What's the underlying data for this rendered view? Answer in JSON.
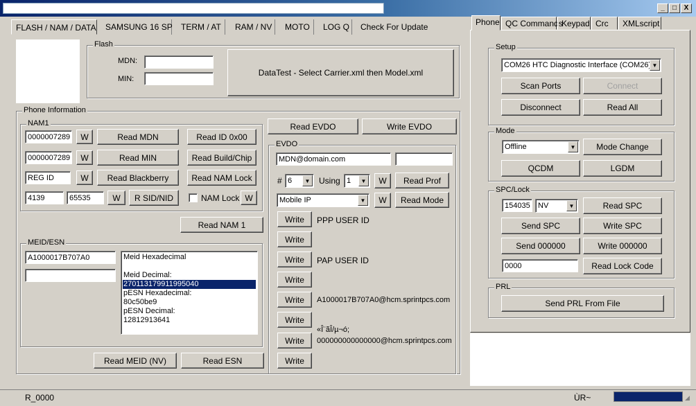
{
  "main_tabs": [
    "FLASH / NAM / DATA",
    "SAMSUNG 16 SP",
    "TERM / AT",
    "RAM / NV",
    "MOTO",
    "LOG Q",
    "Check For Update"
  ],
  "flash": {
    "legend": "Flash",
    "mdn_label": "MDN:",
    "min_label": "MIN:",
    "mdn_value": "",
    "min_value": "",
    "datatest_button": "DataTest - Select Carrier.xml then Model.xml"
  },
  "phone_info": {
    "legend": "Phone Information"
  },
  "nam1": {
    "legend": "NAM1",
    "field1": "0000007289",
    "field2": "0000007289",
    "field3": "REG ID",
    "sid": "4139",
    "nid": "65535",
    "w": "W",
    "read_mdn": "Read MDN",
    "read_min": "Read MIN",
    "read_blackberry": "Read Blackberry",
    "r_sid_nid": "R SID/NID",
    "read_id": "Read ID 0x00",
    "read_build": "Read Build/Chip",
    "read_nam_lock": "Read NAM Lock",
    "nam_lock_label": "NAM Lock",
    "read_nam1": "Read NAM 1"
  },
  "meid": {
    "legend": "MEID/ESN",
    "meid_value": "A1000017B707A0",
    "esn_value": "",
    "list": [
      "Meid Hexadecimal",
      "",
      "Meid Decimal:",
      "270113179911995040",
      "pESN Hexadecimal:",
      "80c50be9",
      "pESN Decimal:",
      "12812913641"
    ],
    "selected_index": 3,
    "read_meid": "Read MEID (NV)",
    "read_esn": "Read ESN"
  },
  "evdo": {
    "read_evdo": "Read EVDO",
    "write_evdo": "Write EVDO",
    "legend": "EVDO",
    "email": "MDN@domain.com",
    "email2": "",
    "hash": "#",
    "profile": "6",
    "using_label": "Using",
    "using": "1",
    "w": "W",
    "read_prof": "Read Prof",
    "mode_select": "Mobile IP",
    "read_mode": "Read Mode",
    "write": "Write",
    "rows": [
      "PPP USER ID",
      "",
      "PAP USER ID",
      "",
      "A1000017B707A0@hcm.sprintpcs.com",
      "",
      "«Î¨ãÎ/µ¬ó;",
      "000000000000000@hcm.sprintpcs.com"
    ]
  },
  "right_tabs": [
    "Phone",
    "QC Commands",
    "Keypad",
    "Crc",
    "XMLscript"
  ],
  "setup": {
    "legend": "Setup",
    "port": "COM26 HTC Diagnostic Interface (COM26)",
    "scan_ports": "Scan Ports",
    "connect": "Connect",
    "disconnect": "Disconnect",
    "read_all": "Read All"
  },
  "mode": {
    "legend": "Mode",
    "mode_value": "Offline",
    "mode_change": "Mode Change",
    "qcdm": "QCDM",
    "lgdm": "LGDM"
  },
  "spc": {
    "legend": "SPC/Lock",
    "spc_value": "154035",
    "nv": "NV",
    "read_spc": "Read SPC",
    "send_spc": "Send SPC",
    "write_spc": "Write SPC",
    "send_000000": "Send 000000",
    "write_000000": "Write 000000",
    "lock_value": "0000",
    "read_lock_code": "Read Lock Code"
  },
  "prl": {
    "legend": "PRL",
    "send_prl": "Send PRL From File"
  },
  "status": {
    "left": "R_0000",
    "right": "ÙR~"
  },
  "window": {
    "min": "_",
    "max": "□",
    "close": "X"
  }
}
